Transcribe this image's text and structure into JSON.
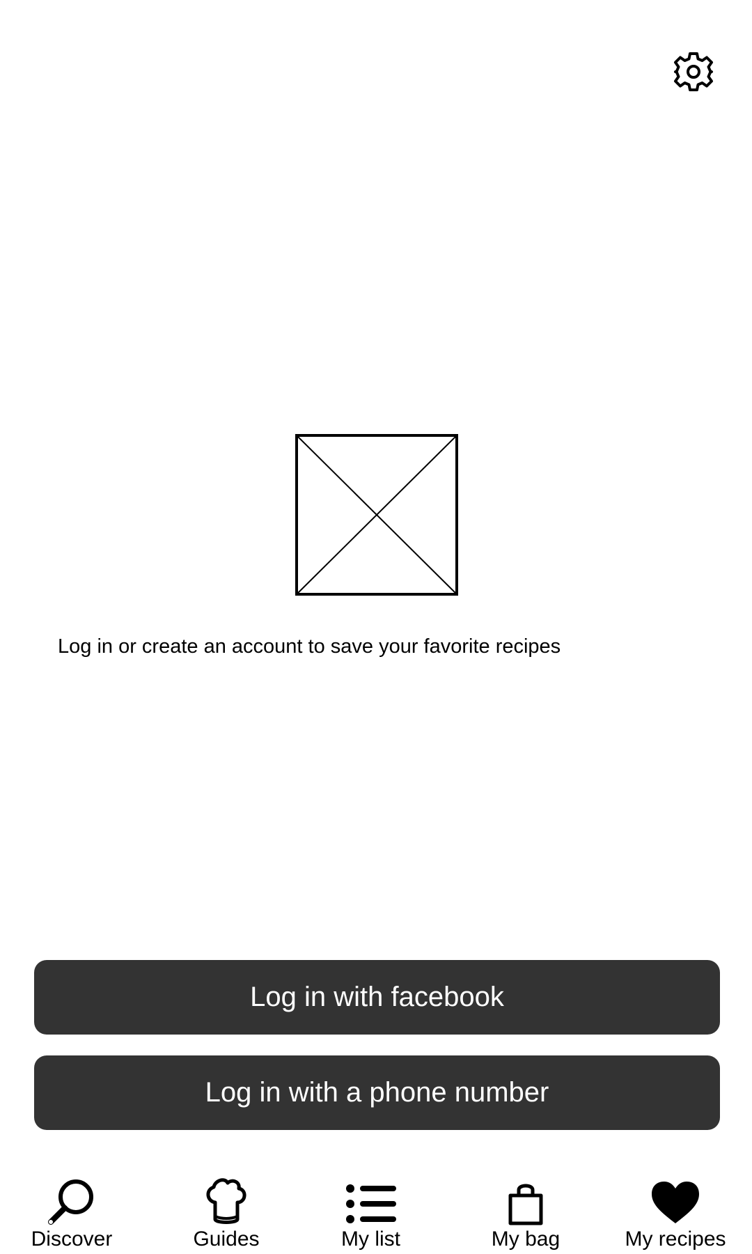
{
  "header": {
    "settings_icon": "gear-icon"
  },
  "empty_state": {
    "image_icon": "image-placeholder-icon",
    "message": "Log in or create an account to save your favorite recipes"
  },
  "auth": {
    "facebook_label": "Log in with facebook",
    "phone_label": "Log in with a phone number",
    "button_color": "#333333",
    "button_text_color": "#ffffff"
  },
  "tabbar": {
    "tabs": [
      {
        "label": "Discover",
        "icon": "search-icon"
      },
      {
        "label": "Guides",
        "icon": "chef-hat-icon"
      },
      {
        "label": "My list",
        "icon": "list-icon"
      },
      {
        "label": "My bag",
        "icon": "shopping-bag-icon"
      },
      {
        "label": "My recipes",
        "icon": "heart-icon"
      }
    ],
    "active_tab": "My recipes"
  }
}
